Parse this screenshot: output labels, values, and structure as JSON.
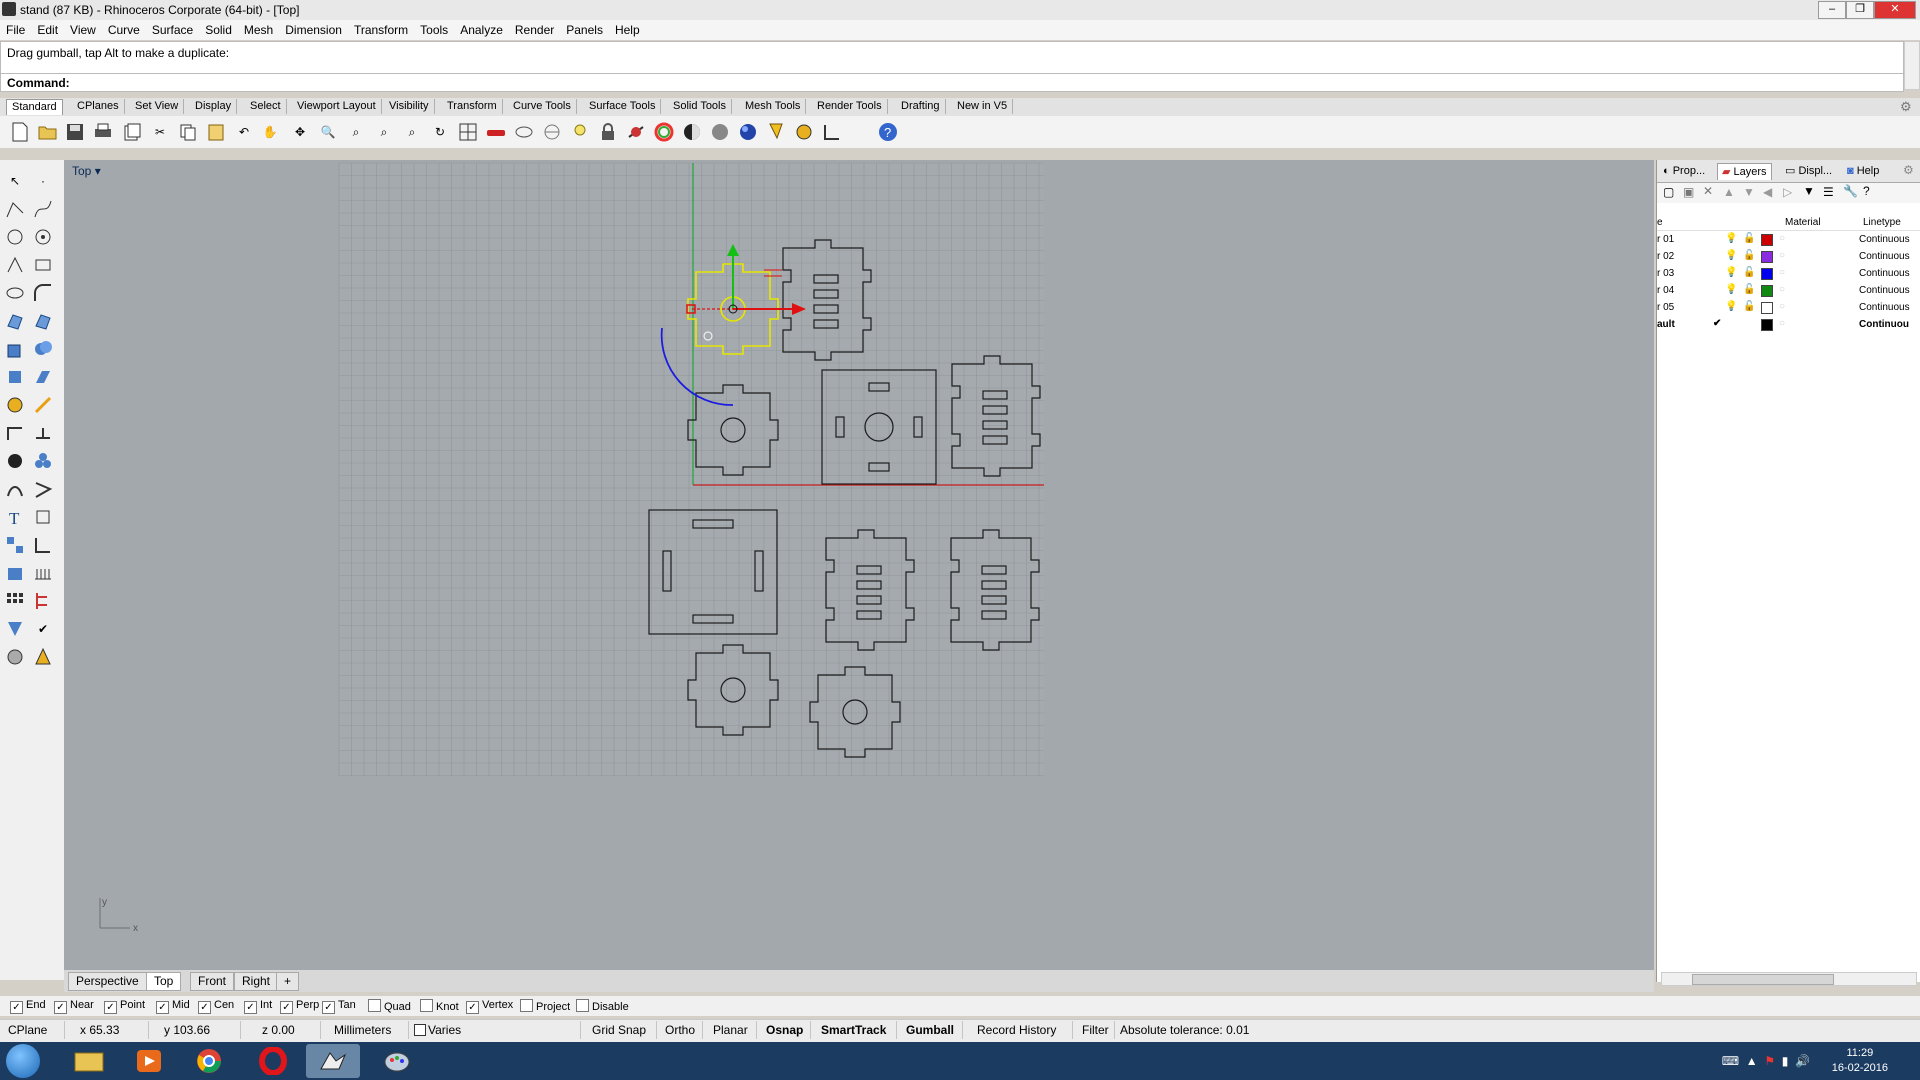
{
  "window": {
    "title": "stand (87 KB) - Rhinoceros Corporate (64-bit) - [Top]"
  },
  "menu": [
    "File",
    "Edit",
    "View",
    "Curve",
    "Surface",
    "Solid",
    "Mesh",
    "Dimension",
    "Transform",
    "Tools",
    "Analyze",
    "Render",
    "Panels",
    "Help"
  ],
  "command": {
    "history": "Drag gumball, tap Alt to make a duplicate:",
    "prompt": "Command:"
  },
  "toolbar_tabs": [
    "Standard",
    "CPlanes",
    "Set View",
    "Display",
    "Select",
    "Viewport Layout",
    "Visibility",
    "Transform",
    "Curve Tools",
    "Surface Tools",
    "Solid Tools",
    "Mesh Tools",
    "Render Tools",
    "Drafting",
    "New in V5"
  ],
  "toolbar_icons": [
    "new-icon",
    "open-icon",
    "save-icon",
    "print-icon",
    "import-icon",
    "cut-icon",
    "copy-icon",
    "paste-icon",
    "undo-icon",
    "pan-hand-icon",
    "rotate-view-icon",
    "zoom-icon",
    "zoom-window-icon",
    "zoom-extents-icon",
    "zoom-selected-icon",
    "zoom-redo-icon",
    "viewport-grid-icon",
    "car-icon",
    "ellipse-icon",
    "snap-icon",
    "light-icon",
    "lock-icon",
    "hide-icon",
    "color-wheel-icon",
    "shade-icon",
    "render-icon",
    "sphere-icon",
    "paint-icon",
    "tools-icon",
    "dimension-icon",
    "help-icon"
  ],
  "viewport": {
    "name": "Top",
    "axis_x": "x",
    "axis_y": "y"
  },
  "view_tabs": [
    "Perspective",
    "Top",
    "Front",
    "Right",
    "+"
  ],
  "active_view_tab": "Top",
  "right_panel": {
    "tabs": [
      "Prop...",
      "Layers",
      "Displ...",
      "Help"
    ],
    "active_tab": "Layers",
    "columns": {
      "name": "e",
      "material": "Material",
      "linetype": "Linetype"
    },
    "layers": [
      {
        "name": "r 01",
        "color": "#cc0000",
        "linetype": "Continuous"
      },
      {
        "name": "r 02",
        "color": "#8a2be2",
        "linetype": "Continuous"
      },
      {
        "name": "r 03",
        "color": "#0000ee",
        "linetype": "Continuous"
      },
      {
        "name": "r 04",
        "color": "#118811",
        "linetype": "Continuous"
      },
      {
        "name": "r 05",
        "color": "#ffffff",
        "linetype": "Continuous"
      },
      {
        "name": "ault",
        "color": "#000000",
        "linetype": "Continuou",
        "current": "✔"
      }
    ]
  },
  "osnaps": [
    {
      "label": "End",
      "checked": true
    },
    {
      "label": "Near",
      "checked": true
    },
    {
      "label": "Point",
      "checked": true
    },
    {
      "label": "Mid",
      "checked": true
    },
    {
      "label": "Cen",
      "checked": true
    },
    {
      "label": "Int",
      "checked": true
    },
    {
      "label": "Perp",
      "checked": true
    },
    {
      "label": "Tan",
      "checked": true
    },
    {
      "label": "Quad",
      "checked": false
    },
    {
      "label": "Knot",
      "checked": false
    },
    {
      "label": "Vertex",
      "checked": true
    },
    {
      "label": "Project",
      "checked": false
    },
    {
      "label": "Disable",
      "checked": false
    }
  ],
  "status": {
    "cplane": "CPlane",
    "x": "x 65.33",
    "y": "y 103.66",
    "z": "z 0.00",
    "units": "Millimeters",
    "layer": "Varies",
    "grid_snap": "Grid Snap",
    "ortho": "Ortho",
    "planar": "Planar",
    "osnap": "Osnap",
    "smarttrack": "SmartTrack",
    "gumball": "Gumball",
    "record_history": "Record History",
    "filter": "Filter",
    "tolerance": "Absolute tolerance: 0.01"
  },
  "taskbar": {
    "time": "11:29",
    "date": "16-02-2016"
  },
  "colors": {
    "viewport_bg": "#a3a8ad",
    "grid": "#8f959a",
    "selection": "#e6e600",
    "gumball_x": "#e01010",
    "gumball_y": "#10c010",
    "gumball_rot": "#1010e0"
  }
}
